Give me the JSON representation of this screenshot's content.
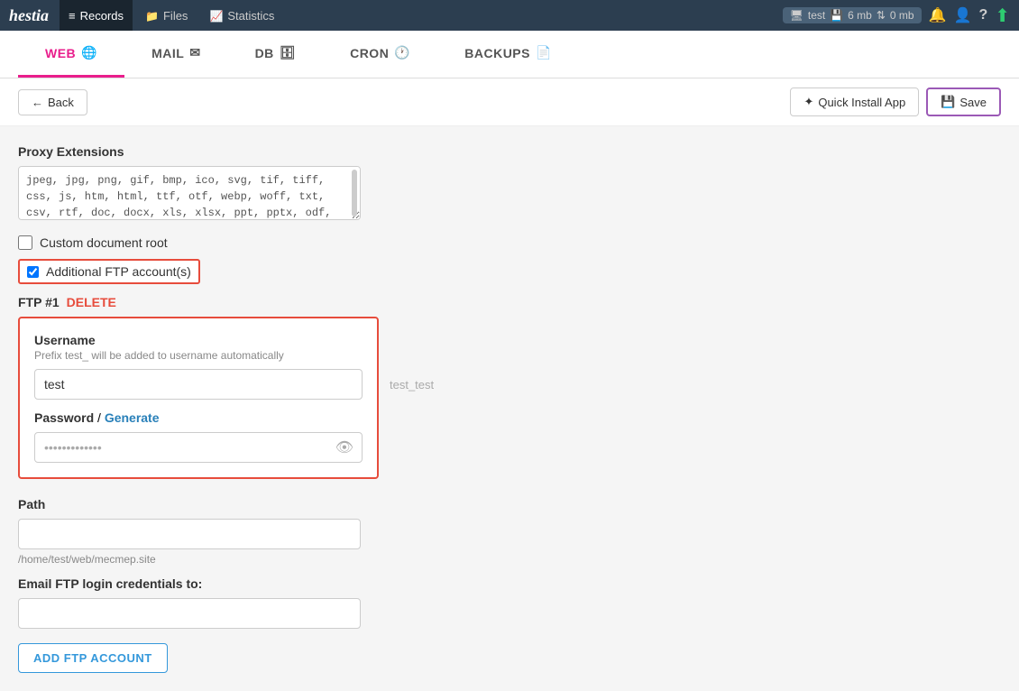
{
  "app": {
    "logo": "hestia",
    "nav_items": [
      {
        "id": "records",
        "label": "Records",
        "active": true
      },
      {
        "id": "files",
        "label": "Files",
        "active": false
      },
      {
        "id": "statistics",
        "label": "Statistics",
        "active": false
      }
    ],
    "server_badge": {
      "name": "test",
      "hdd": "6 mb",
      "net": "0 mb"
    }
  },
  "subnav": {
    "tabs": [
      {
        "id": "web",
        "label": "WEB",
        "active": true
      },
      {
        "id": "mail",
        "label": "MAIL",
        "active": false
      },
      {
        "id": "db",
        "label": "DB",
        "active": false
      },
      {
        "id": "cron",
        "label": "CRON",
        "active": false
      },
      {
        "id": "backups",
        "label": "BACKUPS",
        "active": false
      }
    ]
  },
  "toolbar": {
    "back_label": "Back",
    "quick_install_label": "Quick Install App",
    "save_label": "Save"
  },
  "form": {
    "proxy_extensions_label": "Proxy Extensions",
    "proxy_extensions_value": "jpeg, jpg, png, gif, bmp, ico, svg, tif, tiff, css, js, htm, html, ttf, otf, webp, woff, txt, csv, rtf, doc, docx, xls, xlsx, ppt, pptx, odf, odp, ods, odt, pdf, psd, ai, eot, eps, ps, zip, tar, tgz, gz, rar, bz2, 7z, aac, m4a, mp3, mp4, ogg, wav, wma",
    "custom_doc_root_label": "Custom document root",
    "custom_doc_root_checked": false,
    "additional_ftp_label": "Additional FTP account(s)",
    "additional_ftp_checked": true,
    "ftp_number": "FTP #1",
    "ftp_delete_label": "DELETE",
    "username_label": "Username",
    "username_hint": "Prefix test_ will be added to username automatically",
    "username_value": "test",
    "username_suffix": "test_test",
    "password_label": "Password",
    "password_divider": "/",
    "generate_label": "Generate",
    "password_value": ".............",
    "path_label": "Path",
    "path_value": "",
    "path_hint": "/home/test/web/mecmep.site",
    "email_label": "Email FTP login credentials to:",
    "email_value": "",
    "add_ftp_label": "ADD FTP ACCOUNT"
  }
}
